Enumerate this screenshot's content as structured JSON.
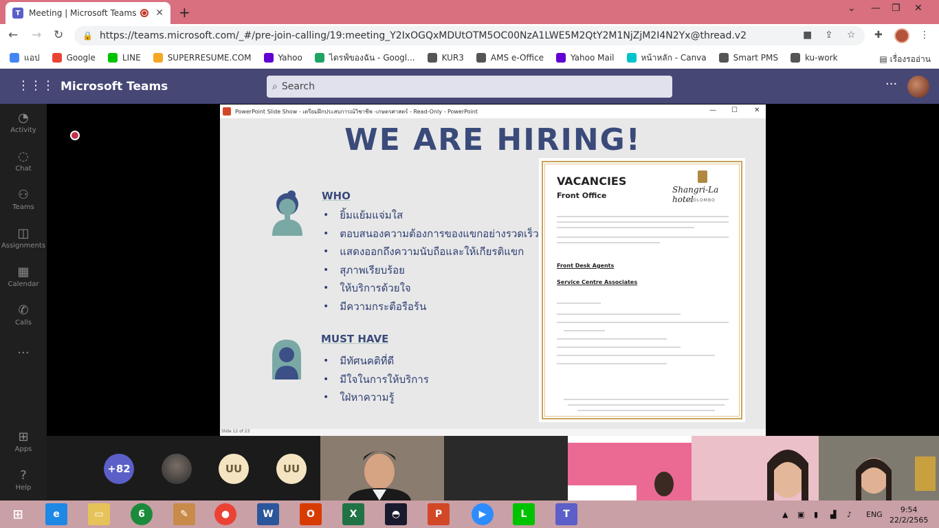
{
  "browser": {
    "tab_title": "Meeting | Microsoft Teams",
    "url": "https://teams.microsoft.com/_#/pre-join-calling/19:meeting_Y2IxOGQxMDUtOTM5OC00NzA1LWE5M2QtY2M1NjZjM2I4N2Yx@thread.v2",
    "bookmarks": [
      {
        "label": "แอป",
        "color": "#4285f4"
      },
      {
        "label": "Google",
        "color": "#ea4335"
      },
      {
        "label": "LINE",
        "color": "#00c300"
      },
      {
        "label": "SUPERRESUME.COM",
        "color": "#f5a623"
      },
      {
        "label": "Yahoo",
        "color": "#6001d2"
      },
      {
        "label": "ไดรฟ์ของฉัน - Googl...",
        "color": "#1fa463"
      },
      {
        "label": "KUR3",
        "color": "#555555"
      },
      {
        "label": "AMS e-Office",
        "color": "#555555"
      },
      {
        "label": "Yahoo Mail",
        "color": "#6001d2"
      },
      {
        "label": "หน้าหลัก - Canva",
        "color": "#00c4cc"
      },
      {
        "label": "Smart PMS",
        "color": "#555555"
      },
      {
        "label": "ku-work",
        "color": "#555555"
      }
    ],
    "reading_list": "เรื่องรออ่าน"
  },
  "teams": {
    "title": "Microsoft Teams",
    "search_placeholder": "Search",
    "rail": [
      {
        "label": "Activity",
        "icon": "bell-icon"
      },
      {
        "label": "Chat",
        "icon": "chat-icon"
      },
      {
        "label": "Teams",
        "icon": "teams-icon"
      },
      {
        "label": "Assignments",
        "icon": "assignments-icon"
      },
      {
        "label": "Calendar",
        "icon": "calendar-icon"
      },
      {
        "label": "Calls",
        "icon": "phone-icon"
      },
      {
        "label": "Apps",
        "icon": "apps-icon"
      },
      {
        "label": "Help",
        "icon": "help-icon"
      }
    ],
    "participants_overflow": "+82",
    "initials_1": "UU",
    "initials_2": "UU"
  },
  "ppt": {
    "window_title": "PowerPoint Slide Show  -  เตรียมฝึกประสบการณ์วิชาชีพ -เกษตรศาสตร์  -  Read-Only  -  PowerPoint",
    "status": "Slide 12 of 23",
    "headline": "WE ARE HIRING!",
    "who_heading": "WHO",
    "who_items": [
      "ยิ้มแย้มแจ่มใส",
      "ตอบสนองความต้องการของแขกอย่างรวดเร็ว",
      "แสดงออกถึงความนับถือและให้เกียรติแขก",
      "สุภาพเรียบร้อย",
      "ให้บริการด้วยใจ",
      "มีความกระตือรือร้น"
    ],
    "must_heading": "MUST HAVE",
    "must_items": [
      "มีทัศนคติที่ดี",
      "มีใจในการให้บริการ",
      "ใฝ่หาความรู้"
    ],
    "card": {
      "title": "VACANCIES",
      "subtitle": "Front Office",
      "brand": "Shangri-La hotel",
      "city": "COLOMBO",
      "job1": "Front Desk Agents",
      "job2": "Service Centre Associates"
    }
  },
  "taskbar": {
    "lang": "ENG",
    "time": "9:54",
    "date": "22/2/2565"
  }
}
